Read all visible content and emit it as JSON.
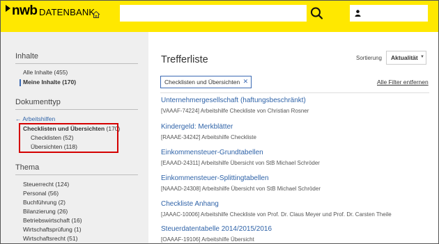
{
  "header": {
    "logo_brand": "nwb",
    "logo_product": "DATENBANK",
    "search_value": "",
    "search_placeholder": ""
  },
  "sidebar": {
    "inhalte_heading": "Inhalte",
    "inhalte_items": [
      {
        "label": "Alle Inhalte (455)",
        "active": false
      },
      {
        "label": "Meine Inhalte (170)",
        "active": true
      }
    ],
    "dokumenttyp_heading": "Dokumenttyp",
    "back_link": "← Arbeitshilfen",
    "selected_type": {
      "label": "Checklisten und Übersichten",
      "count": "(170)"
    },
    "sub_types": [
      {
        "label": "Checklisten (52)"
      },
      {
        "label": "Übersichten (118)"
      }
    ],
    "thema_heading": "Thema",
    "thema_items": [
      {
        "label": "Steuerrecht (124)"
      },
      {
        "label": "Personal (56)"
      },
      {
        "label": "Buchführung (2)"
      },
      {
        "label": "Bilanzierung (26)"
      },
      {
        "label": "Betriebswirtschaft (16)"
      },
      {
        "label": "Wirtschaftsprüfung (1)"
      },
      {
        "label": "Wirtschaftsrecht (51)"
      }
    ]
  },
  "main": {
    "title": "Trefferliste",
    "sort_label": "Sortierung",
    "sort_value": "Aktualität",
    "active_filter": "Checklisten und Übersichten",
    "clear_filters": "Alle Filter entfernen",
    "results": [
      {
        "title": "Unternehmergesellschaft (haftungsbeschränkt)",
        "meta": "[VAAAF-74224] Arbeitshilfe Checkliste von Christian Rosner"
      },
      {
        "title": "Kindergeld: Merkblätter",
        "meta": "[RAAAE-34242] Arbeitshilfe Checkliste"
      },
      {
        "title": "Einkommensteuer-Grundtabellen",
        "meta": "[EAAAD-24311] Arbeitshilfe Übersicht von StB Michael Schröder"
      },
      {
        "title": "Einkommensteuer-Splittingtabellen",
        "meta": "[NAAAD-24308] Arbeitshilfe Übersicht von StB Michael Schröder"
      },
      {
        "title": "Checkliste Anhang",
        "meta": "[JAAAC-10006] Arbeitshilfe Checkliste von Prof. Dr. Claus Meyer und Prof. Dr. Carsten Theile"
      },
      {
        "title": "Steuerdatentabelle 2014/2015/2016",
        "meta": "[OAAAF-19106] Arbeitshilfe Übersicht"
      }
    ]
  },
  "colors": {
    "brand_yellow": "#ffe800",
    "link_blue": "#2f63a8",
    "highlight_red": "#d40000",
    "sidebar_bg": "#efefef"
  },
  "icons": [
    "home-icon",
    "search-icon",
    "user-icon",
    "close-icon",
    "chevron-down-icon"
  ]
}
